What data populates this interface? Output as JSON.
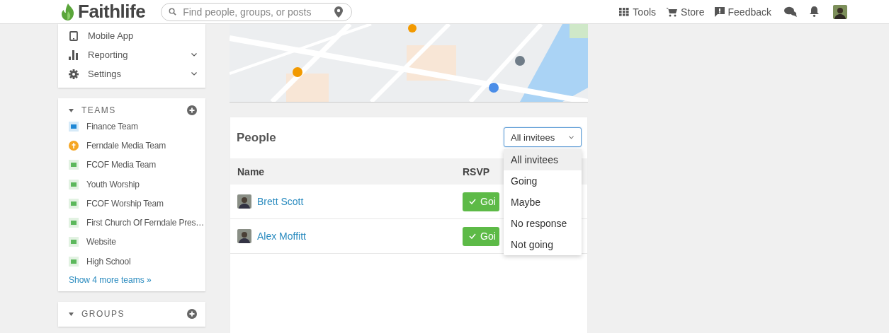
{
  "header": {
    "logo": "Faithlife",
    "search": {
      "placeholder": "Find people, groups, or posts"
    },
    "nav": [
      {
        "label": "Tools",
        "kind": "grid"
      },
      {
        "label": "Store",
        "kind": "cart"
      },
      {
        "label": "Feedback",
        "kind": "flag"
      }
    ]
  },
  "sidebar": {
    "menu": [
      {
        "label": "Mobile App",
        "kind": "phone",
        "expandable": false
      },
      {
        "label": "Reporting",
        "kind": "chart",
        "expandable": true
      },
      {
        "label": "Settings",
        "kind": "gear",
        "expandable": true
      }
    ],
    "teams": {
      "title": "TEAMS",
      "items": [
        {
          "label": "Finance Team",
          "kind": "square",
          "color": "#1e88d6"
        },
        {
          "label": "Ferndale Media Team",
          "kind": "circle",
          "color": "#f5a623"
        },
        {
          "label": "FCOF Media Team",
          "kind": "square",
          "color": "#5cb85c"
        },
        {
          "label": "Youth Worship",
          "kind": "square",
          "color": "#5cb85c"
        },
        {
          "label": "FCOF Worship Team",
          "kind": "square",
          "color": "#5cb85c"
        },
        {
          "label": "First Church Of Ferndale Pres…",
          "kind": "square",
          "color": "#5cb85c"
        },
        {
          "label": "Website",
          "kind": "square",
          "color": "#5cb85c"
        },
        {
          "label": "High School",
          "kind": "square",
          "color": "#5cb85c"
        }
      ],
      "more": "Show 4 more teams »"
    },
    "groups": {
      "title": "GROUPS"
    }
  },
  "people": {
    "title": "People",
    "filter": {
      "value": "All invitees",
      "expanded": true,
      "options": [
        {
          "label": "All invitees",
          "selected": true
        },
        {
          "label": "Going",
          "selected": false
        },
        {
          "label": "Maybe",
          "selected": false
        },
        {
          "label": "No response",
          "selected": false
        },
        {
          "label": "Not going",
          "selected": false
        }
      ]
    },
    "columns": [
      "Name",
      "RSVP"
    ],
    "rows": [
      {
        "name": "Brett Scott",
        "rsvp": "Goi"
      },
      {
        "name": "Alex Moffitt",
        "rsvp": "Goi"
      }
    ]
  }
}
